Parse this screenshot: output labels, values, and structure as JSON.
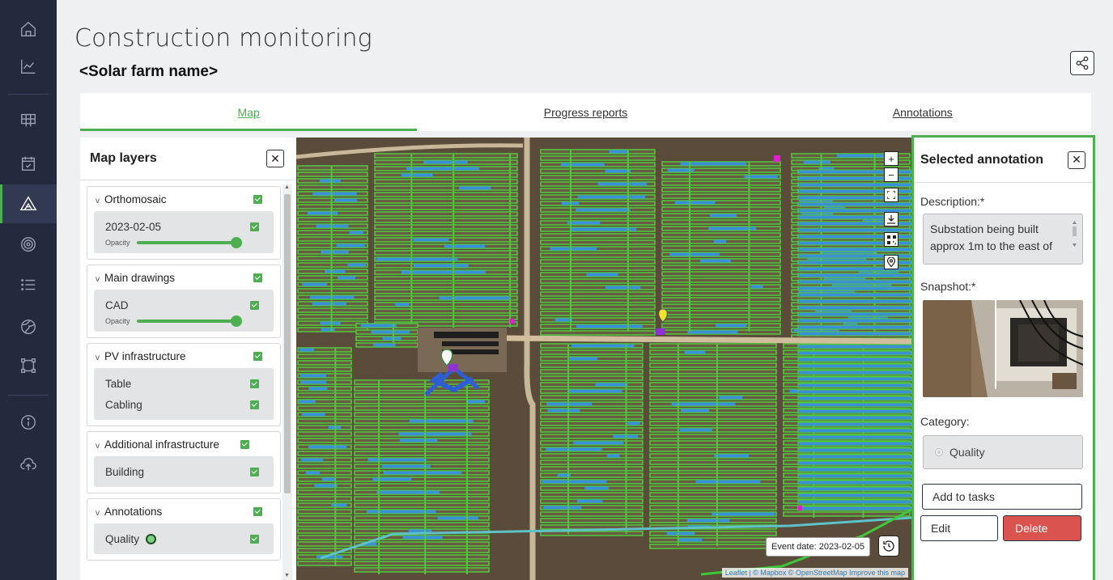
{
  "header": {
    "title": "Construction monitoring",
    "subtitle": "<Solar farm name>"
  },
  "tabs": [
    {
      "label": "Map",
      "active": true
    },
    {
      "label": "Progress reports",
      "active": false
    },
    {
      "label": "Annotations",
      "active": false
    }
  ],
  "sidebar": {
    "items": [
      {
        "icon": "home-icon"
      },
      {
        "icon": "chart-icon"
      },
      {
        "icon": "table-grid-icon"
      },
      {
        "icon": "calendar-check-icon"
      },
      {
        "icon": "construction-icon",
        "active": true
      },
      {
        "icon": "target-icon"
      },
      {
        "icon": "list-icon"
      },
      {
        "icon": "globe-icon"
      },
      {
        "icon": "area-select-icon"
      },
      {
        "icon": "info-icon"
      },
      {
        "icon": "cloud-upload-icon"
      }
    ]
  },
  "layers_panel": {
    "title": "Map layers",
    "groups": [
      {
        "name": "Orthomosaic",
        "checked": true,
        "items": [
          {
            "label": "2023-02-05",
            "checked": true
          }
        ],
        "opacity_label": "Opacity",
        "opacity": 1.0
      },
      {
        "name": "Main drawings",
        "checked": true,
        "items": [
          {
            "label": "CAD",
            "checked": true
          }
        ],
        "opacity_label": "Opacity",
        "opacity": 1.0
      },
      {
        "name": "PV infrastructure",
        "checked": true,
        "items": [
          {
            "label": "Table",
            "checked": true
          },
          {
            "label": "Cabling",
            "checked": true
          }
        ]
      },
      {
        "name": "Additional infrastructure",
        "checked": true,
        "items": [
          {
            "label": "Building",
            "checked": true
          }
        ]
      },
      {
        "name": "Annotations",
        "checked": true,
        "items": [
          {
            "label": "Quality",
            "checked": true
          }
        ]
      }
    ]
  },
  "map": {
    "event_date": "Event date: 2023-02-05",
    "attribution": "Leaflet | © Mapbox © OpenStreetMap Improve this map",
    "controls": [
      "zoom-in-icon",
      "zoom-out-icon",
      "fullscreen-icon",
      "download-icon",
      "qr-icon",
      "location-pin-icon"
    ]
  },
  "annotation_panel": {
    "title": "Selected annotation",
    "description_label": "Description:*",
    "description": "Substation being built approx 1m to the east of",
    "snapshot_label": "Snapshot:*",
    "category_label": "Category:",
    "category": "Quality",
    "add_to_tasks": "Add to tasks",
    "edit": "Edit",
    "delete": "Delete"
  },
  "colors": {
    "accent": "#4caf50",
    "sidebar": "#232a3d",
    "danger": "#d9534f",
    "panel_border": "#4caf50"
  }
}
